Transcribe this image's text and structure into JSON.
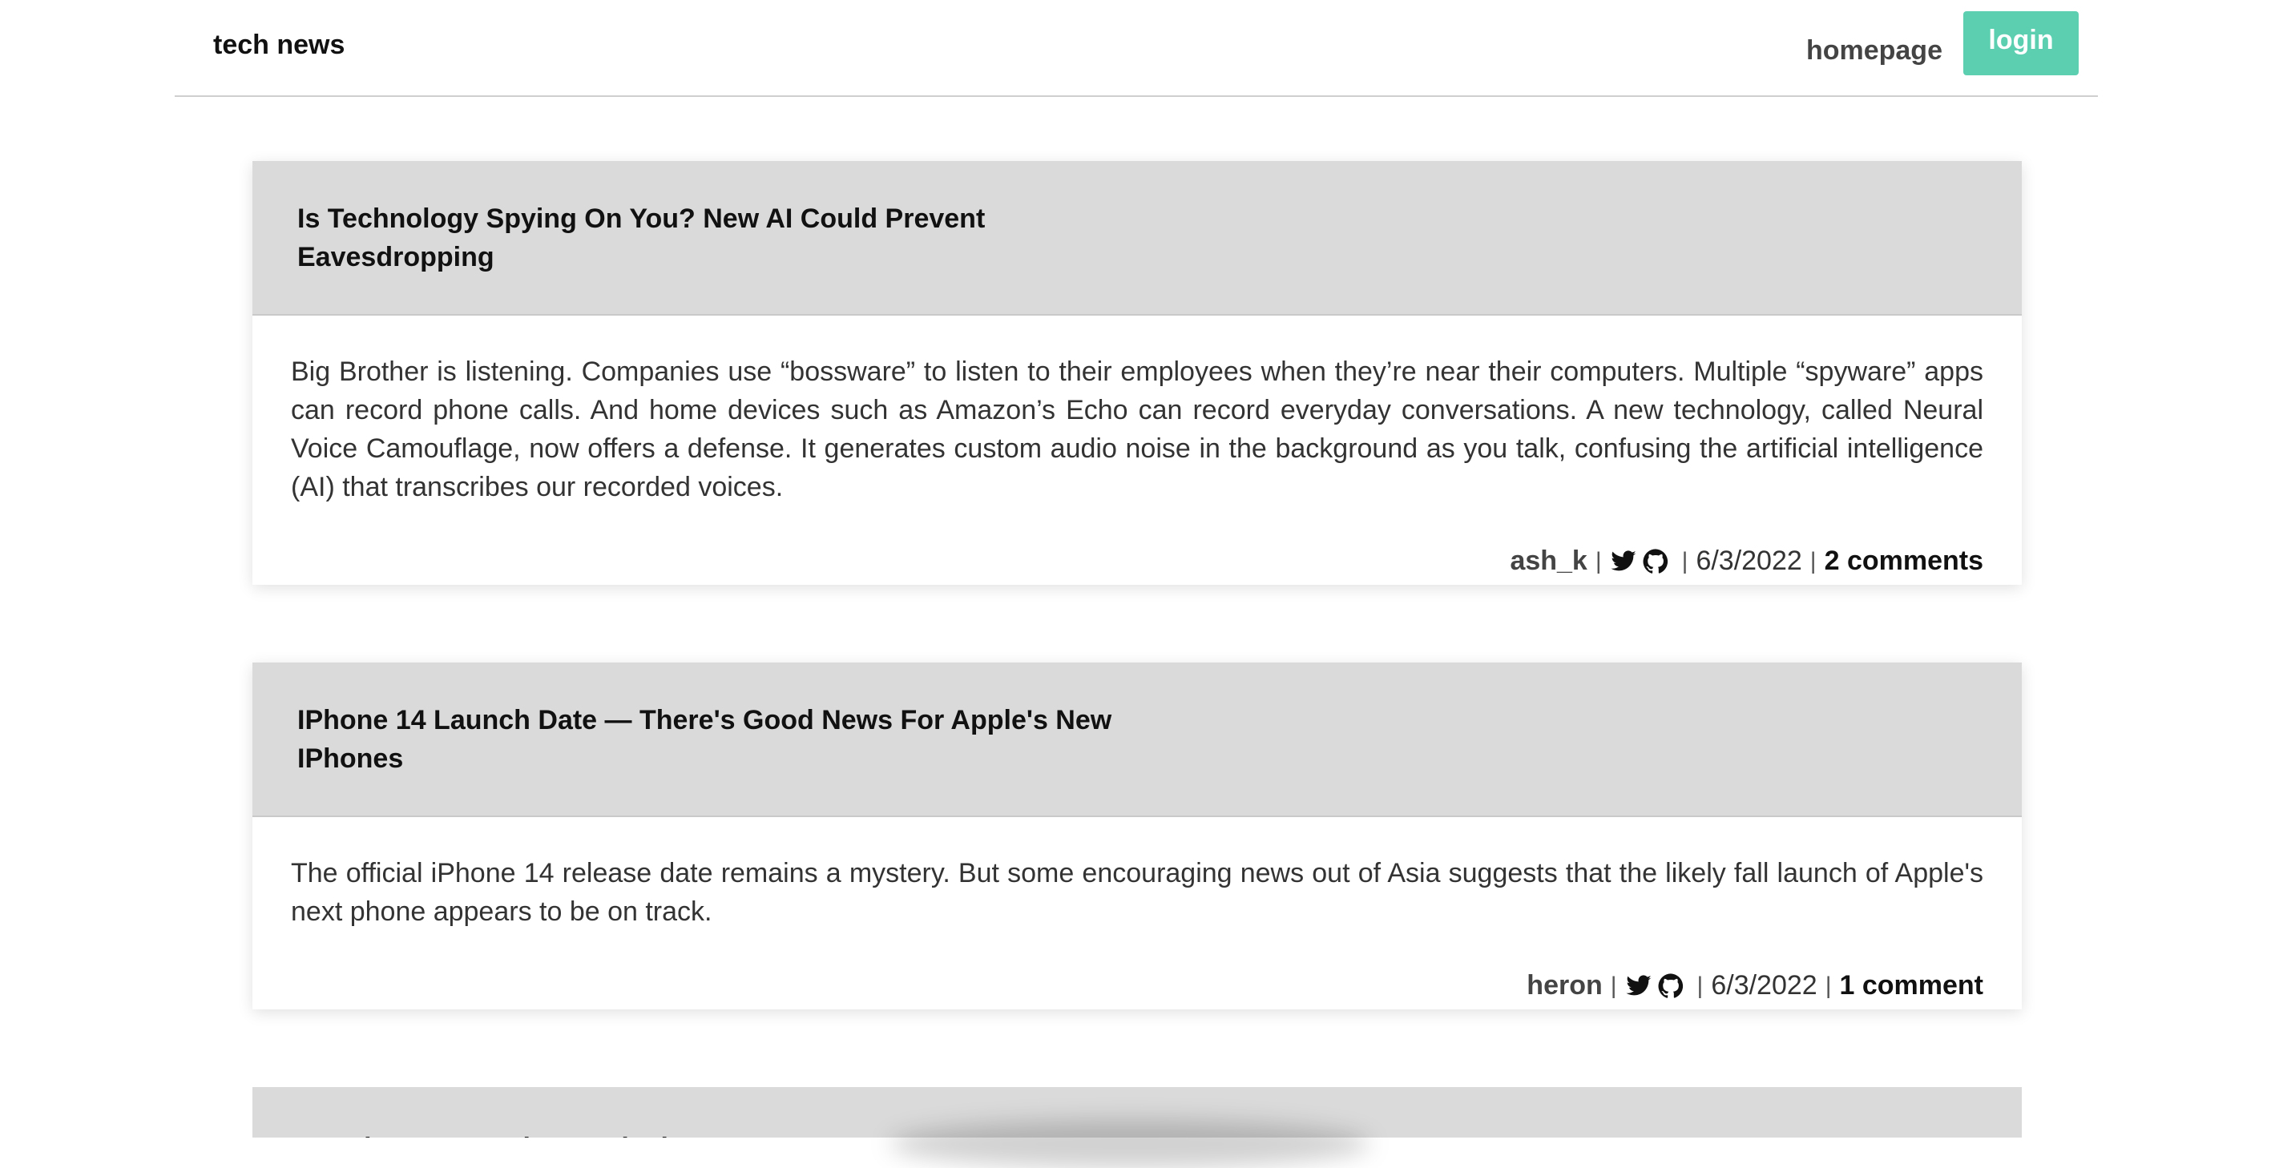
{
  "header": {
    "brand": "tech news",
    "nav_homepage": "homepage",
    "login_label": "login"
  },
  "posts": [
    {
      "title": "Is Technology Spying On You? New AI Could Prevent Eavesdropping",
      "body": "Big Brother is listening. Companies use “bossware” to listen to their employees when they’re near their computers. Multiple “spyware” apps can record phone calls. And home devices such as Amazon’s Echo can record everyday conversations. A new technology, called Neural Voice Camouflage, now offers a defense. It generates custom audio noise in the background as you talk, confusing the artificial intelligence (AI) that transcribes our recorded voices.",
      "author": "ash_k",
      "date": "6/3/2022",
      "comments": "2 comments",
      "sep": "|"
    },
    {
      "title": "IPhone 14 Launch Date — There's Good News For Apple's New IPhones",
      "body": "The official iPhone 14 release date remains a mystery. But some encouraging news out of Asia suggests that the likely fall launch of Apple's next phone appears to be on track.",
      "author": "heron",
      "date": "6/3/2022",
      "comments": "1 comment",
      "sep": "|"
    },
    {
      "title": "People Keep Getting Hacked"
    }
  ],
  "icons": {
    "twitter": "twitter-icon",
    "github": "github-icon"
  },
  "colors": {
    "accent": "#5ccfb1",
    "post_header_bg": "#dadada"
  }
}
